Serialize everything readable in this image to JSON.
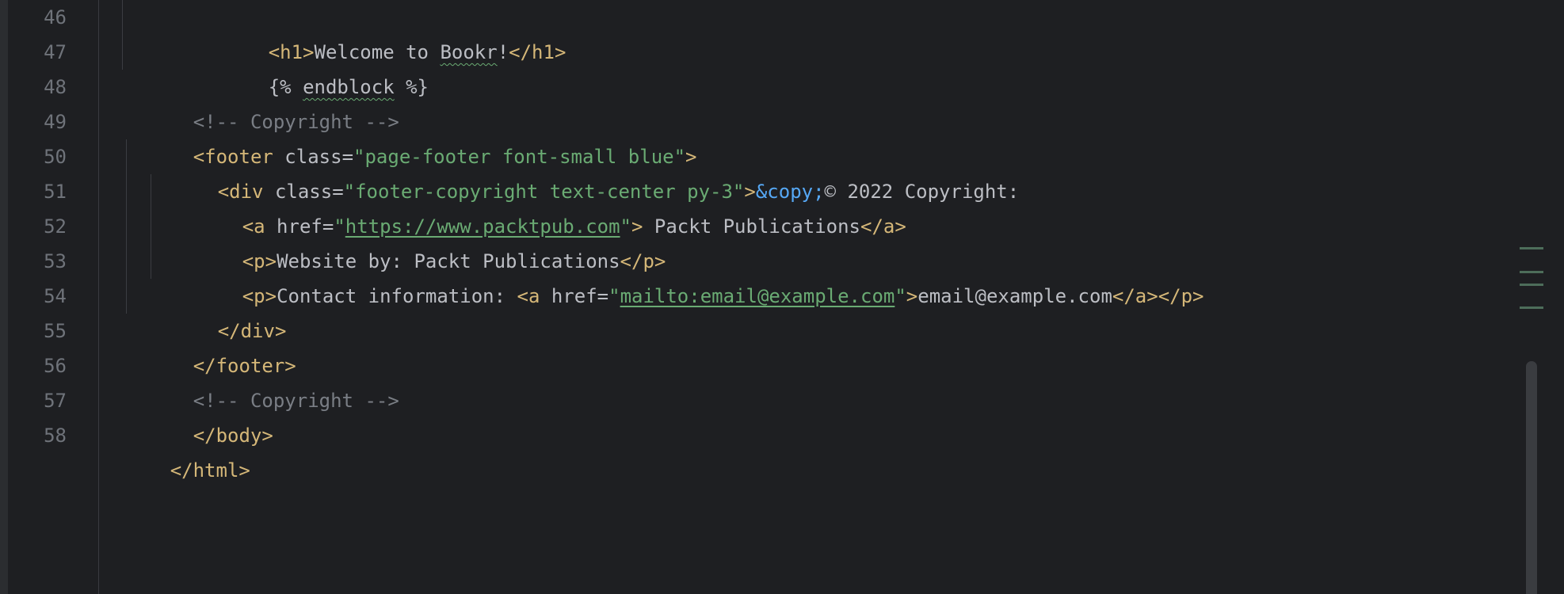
{
  "editor": {
    "line_numbers": [
      "46",
      "47",
      "48",
      "49",
      "50",
      "51",
      "52",
      "53",
      "54",
      "55",
      "56",
      "57",
      "58"
    ],
    "lines": {
      "l46": {
        "tag_open": "<h1>",
        "text_a": "Welcome to ",
        "typo": "Bookr",
        "text_b": "!",
        "tag_close": "</h1>"
      },
      "l47": {
        "text_a": "{% ",
        "typo": "endblock",
        "text_b": " %}"
      },
      "l48": {
        "comment": "<!-- Copyright -->"
      },
      "l49": {
        "tag_open": "<footer",
        "attr": " class",
        "eq": "=",
        "value": "\"page-footer font-small blue\"",
        "tag_end": ">"
      },
      "l50": {
        "tag_open": "<div",
        "attr": " class",
        "eq": "=",
        "value": "\"footer-copyright text-center py-3\"",
        "tag_end": ">",
        "entity": "&copy;",
        "text": "© 2022 Copyright:"
      },
      "l51": {
        "tag_open": "<a",
        "attr": " href",
        "eq": "=",
        "quote_open": "\"",
        "url": "https://www.packtpub.com",
        "quote_close": "\"",
        "tag_end": ">",
        "text": " Packt Publications",
        "tag_close": "</a>"
      },
      "l52": {
        "tag_open": "<p>",
        "text": "Website by: Packt Publications",
        "tag_close": "</p>"
      },
      "l53": {
        "tag_open": "<p>",
        "text": "Contact information: ",
        "tag_a_open": "<a",
        "attr": " href",
        "eq": "=",
        "quote_open": "\"",
        "url": "mailto:email@example.com",
        "quote_close": "\"",
        "tag_end": ">",
        "link_text": "email@example.com",
        "tag_close": "</a></p>"
      },
      "l54": {
        "tag_close": "</div>"
      },
      "l55": {
        "tag_close": "</footer>"
      },
      "l56": {
        "comment": "<!-- Copyright -->"
      },
      "l57": {
        "tag_close": "</body>"
      },
      "l58": {
        "tag_close": "</html>"
      }
    }
  },
  "colors": {
    "background": "#1e1f22",
    "tag": "#d5b778",
    "string": "#6aab73",
    "entity": "#56a8f5",
    "comment": "#7a7e85",
    "text": "#bcbec4",
    "line_number": "#6f737a"
  }
}
